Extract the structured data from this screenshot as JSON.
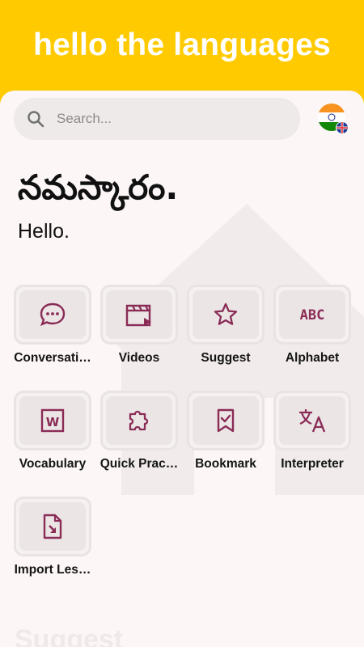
{
  "header": {
    "title": "hello the languages"
  },
  "search": {
    "placeholder": "Search..."
  },
  "flag": {
    "icon": "india-uk-flag-icon"
  },
  "greeting": {
    "native": "నమస్కారం.",
    "english": "Hello."
  },
  "colors": {
    "header": "#ffcb00",
    "accent": "#8a2c56",
    "tile_border": "#e9e3e3"
  },
  "tiles": [
    {
      "label": "Conversati…",
      "icon": "chat-bubble-icon"
    },
    {
      "label": "Videos",
      "icon": "clapperboard-icon"
    },
    {
      "label": "Suggest",
      "icon": "star-icon"
    },
    {
      "label": "Alphabet",
      "icon": "abc-icon"
    },
    {
      "label": "Vocabulary",
      "icon": "word-document-icon"
    },
    {
      "label": "Quick Prac…",
      "icon": "puzzle-icon"
    },
    {
      "label": "Bookmark",
      "icon": "bookmark-check-icon"
    },
    {
      "label": "Interpreter",
      "icon": "translate-icon"
    },
    {
      "label": "Import Les…",
      "icon": "import-file-icon"
    }
  ],
  "section": {
    "suggest_heading": "Suggest"
  }
}
